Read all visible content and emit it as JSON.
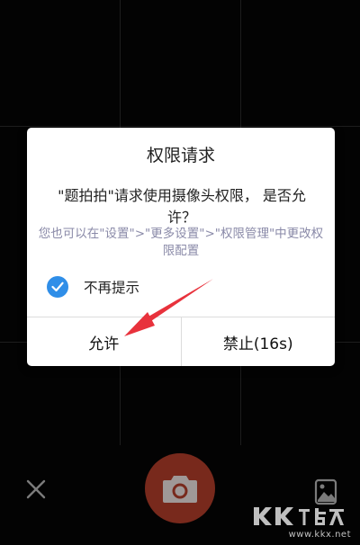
{
  "dialog": {
    "title": "权限请求",
    "message": "\"题拍拍\"请求使用摄像头权限， 是否允许？",
    "hint": "您也可以在\"设置\">\"更多设置\">\"权限管理\"中更改权限配置",
    "checkbox_label": "不再提示",
    "checkbox_checked": true,
    "allow_label": "允许",
    "deny_label": "禁止(16s)"
  },
  "camera": {
    "close_icon": "close-icon",
    "shutter_icon": "camera-icon",
    "gallery_icon": "gallery-icon"
  },
  "watermark": {
    "url": "www.kkx.net"
  },
  "colors": {
    "accent": "#2f8ee8",
    "shutter": "#b9402c",
    "annotation": "#e8323c",
    "hint_text": "#8a8aa8"
  }
}
